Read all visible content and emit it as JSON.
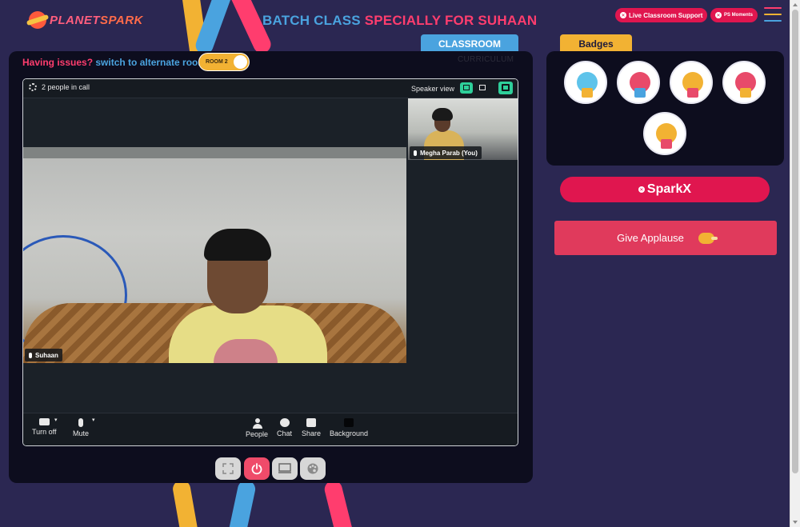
{
  "app": {
    "logo_text_a": "PLANET",
    "logo_text_b": "SPARK",
    "title_part1": "BATCH CLASS ",
    "title_part2": "SPECIALLY FOR SUHAAN"
  },
  "header": {
    "live_support_label": "Live Classroom Support",
    "ps_moments_label": "PS Moments",
    "menu_icon": "hamburger-icon"
  },
  "tabs": {
    "classroom": "CLASSROOM",
    "curriculum": "CURRICULUM"
  },
  "room": {
    "issues_text": "Having issues?",
    "switch_text": " switch to alternate room",
    "toggle_label": "ROOM 2"
  },
  "call": {
    "people_count": "2 people in call",
    "speaker_view_label": "Speaker view",
    "participants": [
      {
        "name": "Suhaan"
      },
      {
        "name": "Megha Parab (You)"
      }
    ]
  },
  "controls": {
    "turn_off": "Turn off",
    "mute": "Mute",
    "people": "People",
    "chat": "Chat",
    "share": "Share",
    "background": "Background"
  },
  "bottom_actions": {
    "fullscreen_icon": "fullscreen-icon",
    "power_icon": "power-icon",
    "screen_icon": "screen-icon",
    "palette_icon": "palette-icon"
  },
  "sidebar": {
    "badges_title": "Badges",
    "sparkx_label": "SparkX",
    "applause_label": "Give Applause"
  },
  "colors": {
    "background": "#2b2752",
    "accent_red": "#e0164f",
    "accent_blue": "#4aa3df",
    "accent_yellow": "#f2b233",
    "accent_pink": "#ff3d6e",
    "panel": "#0d0d1e",
    "teal": "#2ecf9a"
  }
}
